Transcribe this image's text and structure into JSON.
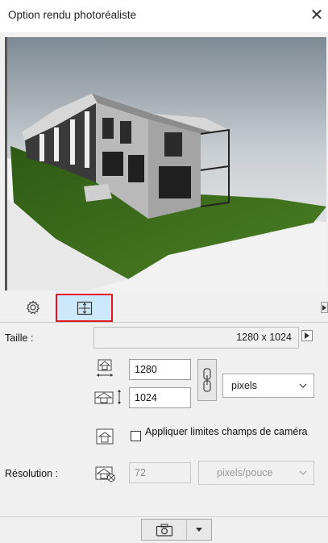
{
  "window": {
    "title": "Option rendu photoréaliste",
    "close_glyph": "✕"
  },
  "tabs": [
    {
      "name": "settings",
      "icon": "gear-icon",
      "selected": false
    },
    {
      "name": "size",
      "icon": "frame-size-icon",
      "selected": true
    }
  ],
  "size": {
    "label": "Taille :",
    "current": "1280 x 1024",
    "width": "1280",
    "height": "1024",
    "unit": "pixels"
  },
  "camera_limits": {
    "label": "Appliquer limites champs de caméra",
    "checked": false
  },
  "resolution": {
    "label": "Résolution :",
    "value": "72",
    "unit": "pixels/pouce",
    "enabled": false
  },
  "colors": {
    "selected_tab_fill": "#cce8fa",
    "selected_tab_border": "#e2171e",
    "grass": "#3f6d1f"
  }
}
